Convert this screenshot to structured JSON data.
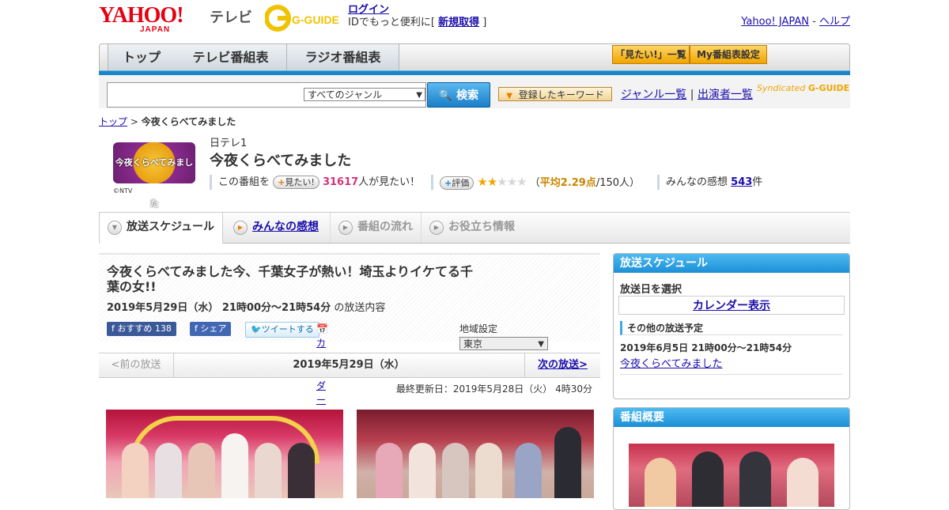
{
  "header": {
    "yahoo_logo": "YAHOO!",
    "japan_text": "JAPAN",
    "service_name": "テレビ",
    "gguide_logo": "G-GUIDE",
    "login_label": "ログイン",
    "login_message_prefix": "IDでもっと便利に[",
    "register_label": "新規取得",
    "login_message_suffix": "]",
    "yahoo_japan_link": "Yahoo! JAPAN",
    "separator": "-",
    "help_link": "ヘルプ"
  },
  "nav": {
    "tabs": [
      "トップ",
      "テレビ番組表",
      "ラジオ番組表"
    ],
    "mitai_list": "「見たい!」一覧",
    "my_schedule": "My番組表設定"
  },
  "search": {
    "genre_selected": "すべてのジャンル",
    "search_button": "検索",
    "keyword_button": "登録したキーワード",
    "genre_list_link": "ジャンル一覧",
    "divider": "|",
    "cast_list_link": "出演者一覧",
    "syndicated_text": "Syndicated",
    "syndicated_logo": "G-GUIDE"
  },
  "breadcrumb": {
    "top": "トップ",
    "separator": ">",
    "current": "今夜くらべてみました"
  },
  "program": {
    "logo_text": "今夜くらべてみました",
    "copyright": "©NTV",
    "channel": "日テレ1",
    "title": "今夜くらべてみました",
    "mitai_prefix": "この番組を",
    "mitai_button": "見たい!",
    "mitai_count": "31617",
    "mitai_suffix": "人が見たい！",
    "rate_button": "評価",
    "rating": 2.29,
    "rating_open": "（",
    "rating_avg_label": "平均2.29点",
    "rating_count": "/150人）",
    "impressions_label": "みんなの感想",
    "impressions_count": "543",
    "impressions_unit": "件"
  },
  "program_tabs": [
    "放送スケジュール",
    "みんなの感想",
    "番組の流れ",
    "お役立ち情報"
  ],
  "episode": {
    "title": "今夜くらべてみました今、千葉女子が熱い！埼玉よりイケてる千葉の女!!",
    "datetime": "2019年5月29日（水） 21時00分～21時54分",
    "content_label": "の放送内容",
    "fb_recommend": "おすすめ",
    "fb_recommend_count": "138",
    "fb_share": "シェア",
    "tweet": "ツイートする",
    "calendar_register": "カレンダーに登録",
    "region_label": "地域設定",
    "region_selected": "東京"
  },
  "pager": {
    "prev": "<前の放送",
    "current": "2019年5月29日（水）",
    "next": "次の放送>"
  },
  "last_updated": "最終更新日：2019年5月28日（火） 4時30分",
  "sidebar": {
    "schedule_header": "放送スケジュール",
    "select_date_label": "放送日を選択",
    "calendar_button": "カレンダー表示",
    "other_schedule_header": "その他の放送予定",
    "other_date": "2019年6月5日 21時00分～21時54分",
    "other_title": "今夜くらべてみました",
    "summary_header": "番組概要"
  },
  "colors": {
    "accent_blue": "#1a86c8",
    "link": "#1a0dab",
    "yahoo_red": "#e60012",
    "pink_count": "#d6337a",
    "rating_gold": "#f0a500"
  }
}
